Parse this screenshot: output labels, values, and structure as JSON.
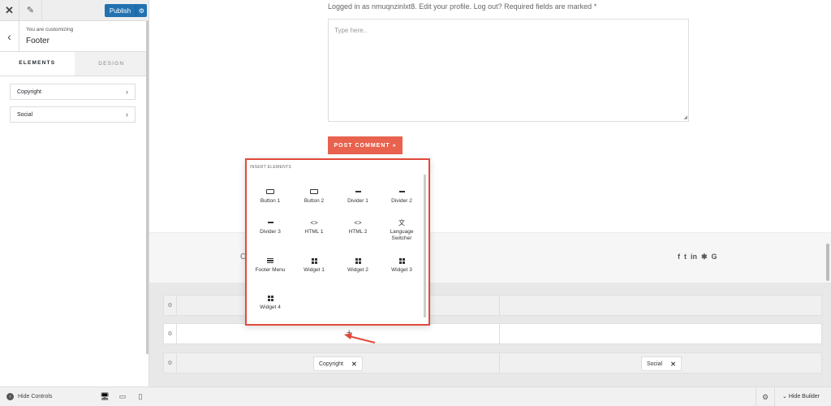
{
  "panel": {
    "publish_label": "Publish",
    "customizing_label": "You are customizing",
    "section_title": "Footer",
    "tabs": [
      {
        "label": "ELEMENTS",
        "active": true
      },
      {
        "label": "DESIGN",
        "active": false
      }
    ],
    "items": [
      {
        "label": "Copyright"
      },
      {
        "label": "Social"
      }
    ],
    "hide_controls_label": "Hide Controls",
    "devices": [
      "desktop-icon",
      "tablet-icon",
      "mobile-icon"
    ]
  },
  "preview": {
    "logged_in_text": "Logged in as nmuqnzinlxt8. Edit your profile. Log out? Required fields are marked *",
    "comment_placeholder": "Type here..",
    "post_comment_label": "POST COMMENT »",
    "footer_hint": "C",
    "social_icons": [
      "facebook-icon",
      "twitter-icon",
      "linkedin-icon",
      "yelp-icon",
      "google-icon"
    ],
    "social_glyphs": [
      "f",
      "t",
      "in",
      "✱",
      "G"
    ]
  },
  "builder": {
    "chips": [
      {
        "label": "Copyright"
      },
      {
        "label": "Social"
      }
    ],
    "hide_builder_label": "Hide Builder",
    "add_glyph": "+"
  },
  "popup": {
    "title": "INSERT ELEMENTS",
    "items": [
      {
        "label": "Button 1",
        "icon": "button-icon"
      },
      {
        "label": "Button 2",
        "icon": "button-icon"
      },
      {
        "label": "Divider 1",
        "icon": "divider-icon"
      },
      {
        "label": "Divider 2",
        "icon": "divider-icon"
      },
      {
        "label": "Divider 3",
        "icon": "divider-icon"
      },
      {
        "label": "HTML 1",
        "icon": "code-icon"
      },
      {
        "label": "HTML 2",
        "icon": "code-icon"
      },
      {
        "label": "Language Switcher",
        "icon": "language-icon"
      },
      {
        "label": "Footer Menu",
        "icon": "menu-icon"
      },
      {
        "label": "Widget 1",
        "icon": "widget-icon"
      },
      {
        "label": "Widget 2",
        "icon": "widget-icon"
      },
      {
        "label": "Widget 3",
        "icon": "widget-icon"
      },
      {
        "label": "Widget 4",
        "icon": "widget-icon"
      }
    ]
  },
  "colors": {
    "publish": "#2271b1",
    "post_comment": "#e8624e",
    "highlight": "#e24a3b"
  }
}
